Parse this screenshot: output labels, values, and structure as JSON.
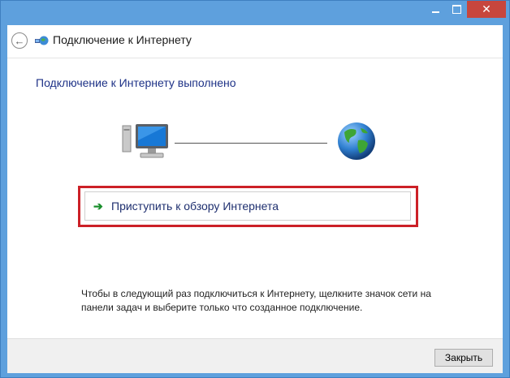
{
  "window": {
    "controls": {
      "minimize_icon": "minimize-icon",
      "maximize_icon": "maximize-icon",
      "close_glyph": "✕"
    },
    "header": {
      "title": "Подключение к Интернету",
      "back_glyph": "←"
    }
  },
  "main": {
    "heading": "Подключение к Интернету выполнено",
    "action": {
      "arrow": "➔",
      "label": "Приступить к обзору Интернета"
    },
    "note": "Чтобы в следующий раз подключиться к Интернету, щелкните значок сети на панели задач и выберите только что созданное подключение."
  },
  "footer": {
    "close_label": "Закрыть"
  },
  "colors": {
    "titlebar": "#5ea0dd",
    "close_button": "#c7463d",
    "heading_text": "#1e3287",
    "highlight_border": "#cc2027",
    "arrow": "#1a8f2c"
  }
}
